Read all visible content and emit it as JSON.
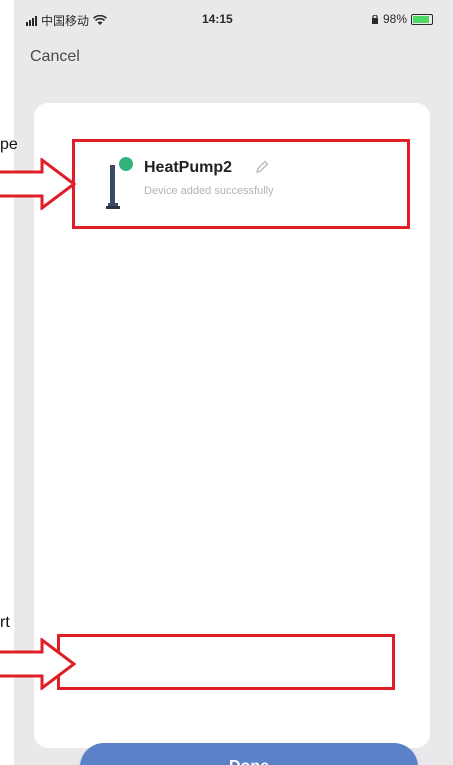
{
  "status_bar": {
    "carrier": "中国移动",
    "time": "14:15",
    "battery": "98%"
  },
  "header": {
    "cancel_label": "Cancel"
  },
  "device": {
    "name": "HeatPump2",
    "status": "Device added successfully"
  },
  "footer": {
    "done_label": "Done"
  },
  "annotations": {
    "label_top": "pe",
    "label_bottom": "rt"
  },
  "colors": {
    "accent_button": "#5b82c8",
    "online_dot": "#35b37e",
    "annotation_red": "#e01e26"
  }
}
